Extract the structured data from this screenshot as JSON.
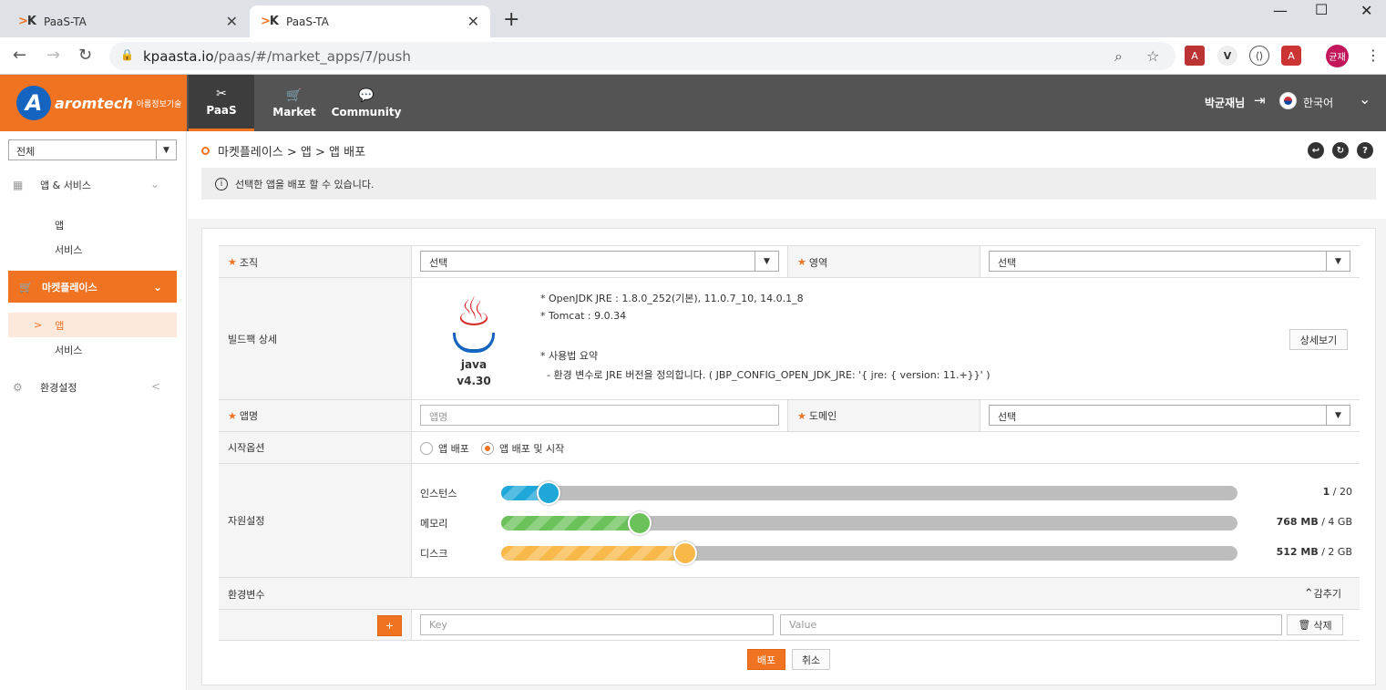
{
  "browser": {
    "tabs": [
      {
        "title": "PaaS-TA"
      },
      {
        "title": "PaaS-TA"
      }
    ],
    "url_host": "kpaasta.io",
    "url_path": "/paas/#/market_apps/7/push",
    "profile_label": "균재"
  },
  "header": {
    "brand_name": "aromtech",
    "brand_sub": "아롬정보기술",
    "nav": [
      {
        "label": "PaaS",
        "icon": "tools-icon"
      },
      {
        "label": "Market",
        "icon": "cart-icon"
      },
      {
        "label": "Community",
        "icon": "chat-icon"
      }
    ],
    "user": "박균재님",
    "language": "한국어"
  },
  "sidebar": {
    "scope_value": "전체",
    "groups": [
      {
        "label": "앱 & 서비스",
        "items": [
          "앱",
          "서비스"
        ]
      },
      {
        "label": "마켓플레이스",
        "items": [
          "앱",
          "서비스"
        ]
      },
      {
        "label": "환경설정",
        "items": []
      }
    ]
  },
  "breadcrumb": "마켓플레이스 > 앱 > 앱 배포",
  "info_text": "선택한 앱을 배포 할 수 있습니다.",
  "form": {
    "org_label": "조직",
    "org_value": "선택",
    "space_label": "영역",
    "space_value": "선택",
    "buildpack_label": "빌드팩 상세",
    "buildpack_name": "java",
    "buildpack_version": "v4.30",
    "buildpack_lines": [
      "* OpenJDK JRE : 1.8.0_252(기본), 11.0.7_10, 14.0.1_8",
      "* Tomcat : 9.0.34",
      "* 사용법 요약",
      "  - 환경 변수로 JRE 버전을 정의합니다. ( JBP_CONFIG_OPEN_JDK_JRE: '{ jre: { version: 11.+}}' )"
    ],
    "detail_button": "상세보기",
    "appname_label": "앱명",
    "appname_placeholder": "앱명",
    "domain_label": "도메인",
    "domain_value": "선택",
    "start_label": "시작옵션",
    "start_options": [
      {
        "label": "앱 배포",
        "selected": false
      },
      {
        "label": "앱 배포 및 시작",
        "selected": true
      }
    ],
    "resource_label": "자원설정",
    "resources": [
      {
        "label": "인스턴스",
        "value": "1",
        "max": "20",
        "unit_text": "/ 20",
        "fraction": 0.05,
        "color": "#1ea7d8"
      },
      {
        "label": "메모리",
        "value": "768 MB",
        "unit_text": "/ 4 GB",
        "fraction": 0.1875,
        "color": "#6cc25a"
      },
      {
        "label": "디스크",
        "value": "512 MB",
        "unit_text": "/ 2 GB",
        "fraction": 0.25,
        "color": "#f9b94a"
      }
    ],
    "env_label": "환경변수",
    "env_toggle": "감추기",
    "key_placeholder": "Key",
    "value_placeholder": "Value",
    "delete_button": "삭제",
    "add_button": "+"
  },
  "actions": {
    "deploy": "배포",
    "cancel": "취소"
  },
  "colors": {
    "accent": "#f07322",
    "header": "#545454"
  }
}
